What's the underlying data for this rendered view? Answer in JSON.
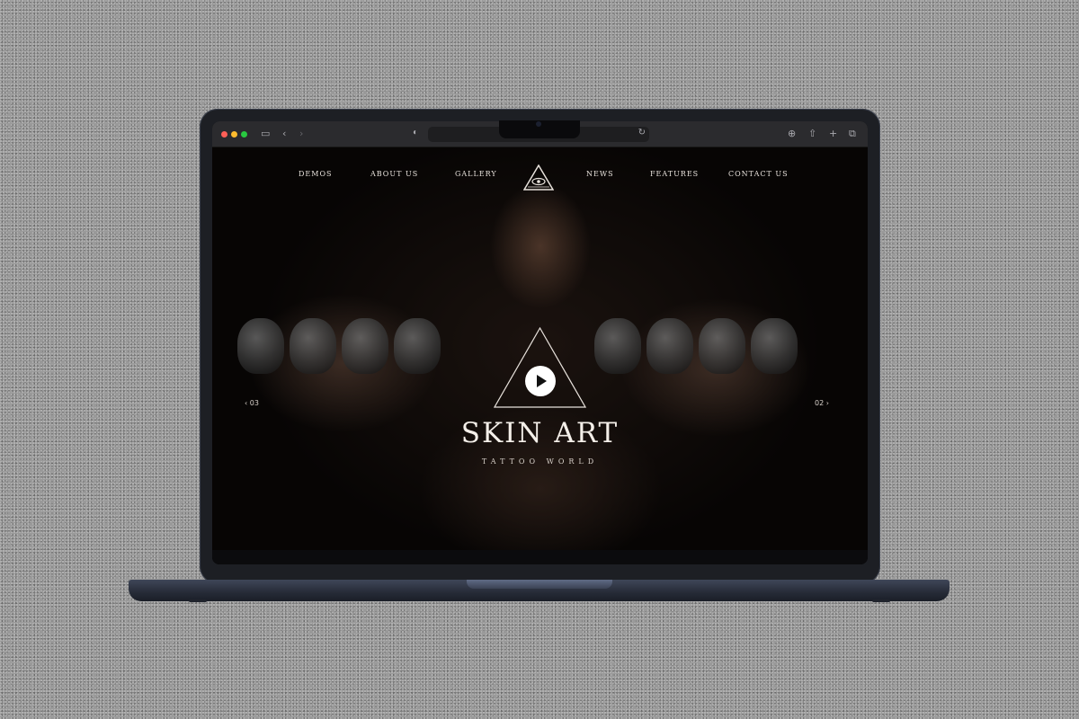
{
  "nav": {
    "items": [
      "DEMOS",
      "ABOUT US",
      "GALLERY",
      "NEWS",
      "FEATURES",
      "CONTACT US"
    ]
  },
  "hero": {
    "title": "SKIN ART",
    "subtitle": "TATTOO WORLD",
    "slide_prev": "03",
    "slide_next": "02"
  },
  "colors": {
    "accent": "#f4efe9",
    "screen_bg": "#000000",
    "laptop_body": "#262b37"
  },
  "icons": {
    "browser": [
      "sidebar-icon",
      "back-icon",
      "forward-icon",
      "shield-icon",
      "reload-icon",
      "download-icon",
      "share-icon",
      "new-tab-icon",
      "tabs-overview-icon"
    ],
    "site": [
      "eye-triangle-logo-icon",
      "play-icon",
      "chevron-left-icon",
      "chevron-right-icon"
    ]
  }
}
